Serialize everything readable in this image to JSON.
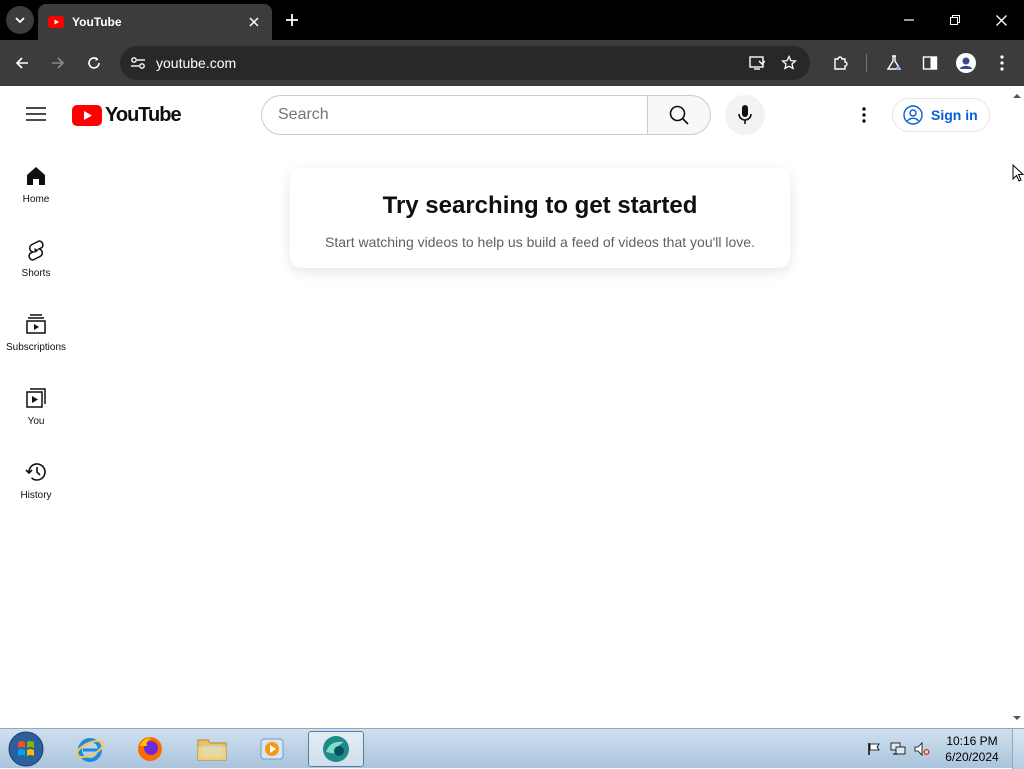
{
  "browser": {
    "tab_title": "YouTube",
    "url": "youtube.com"
  },
  "youtube": {
    "logo_text": "YouTube",
    "search_placeholder": "Search",
    "sign_in_label": "Sign in",
    "guide": [
      {
        "label": "Home",
        "icon": "home-icon"
      },
      {
        "label": "Shorts",
        "icon": "shorts-icon"
      },
      {
        "label": "Subscriptions",
        "icon": "subscriptions-icon"
      },
      {
        "label": "You",
        "icon": "you-icon"
      },
      {
        "label": "History",
        "icon": "history-icon"
      }
    ],
    "prompt_title": "Try searching to get started",
    "prompt_subtitle": "Start watching videos to help us build a feed of videos that you'll love."
  },
  "taskbar": {
    "time": "10:16 PM",
    "date": "6/20/2024"
  },
  "colors": {
    "youtube_red": "#ff0000",
    "link_blue": "#065fd4",
    "chrome_dark": "#3c3c3c"
  }
}
